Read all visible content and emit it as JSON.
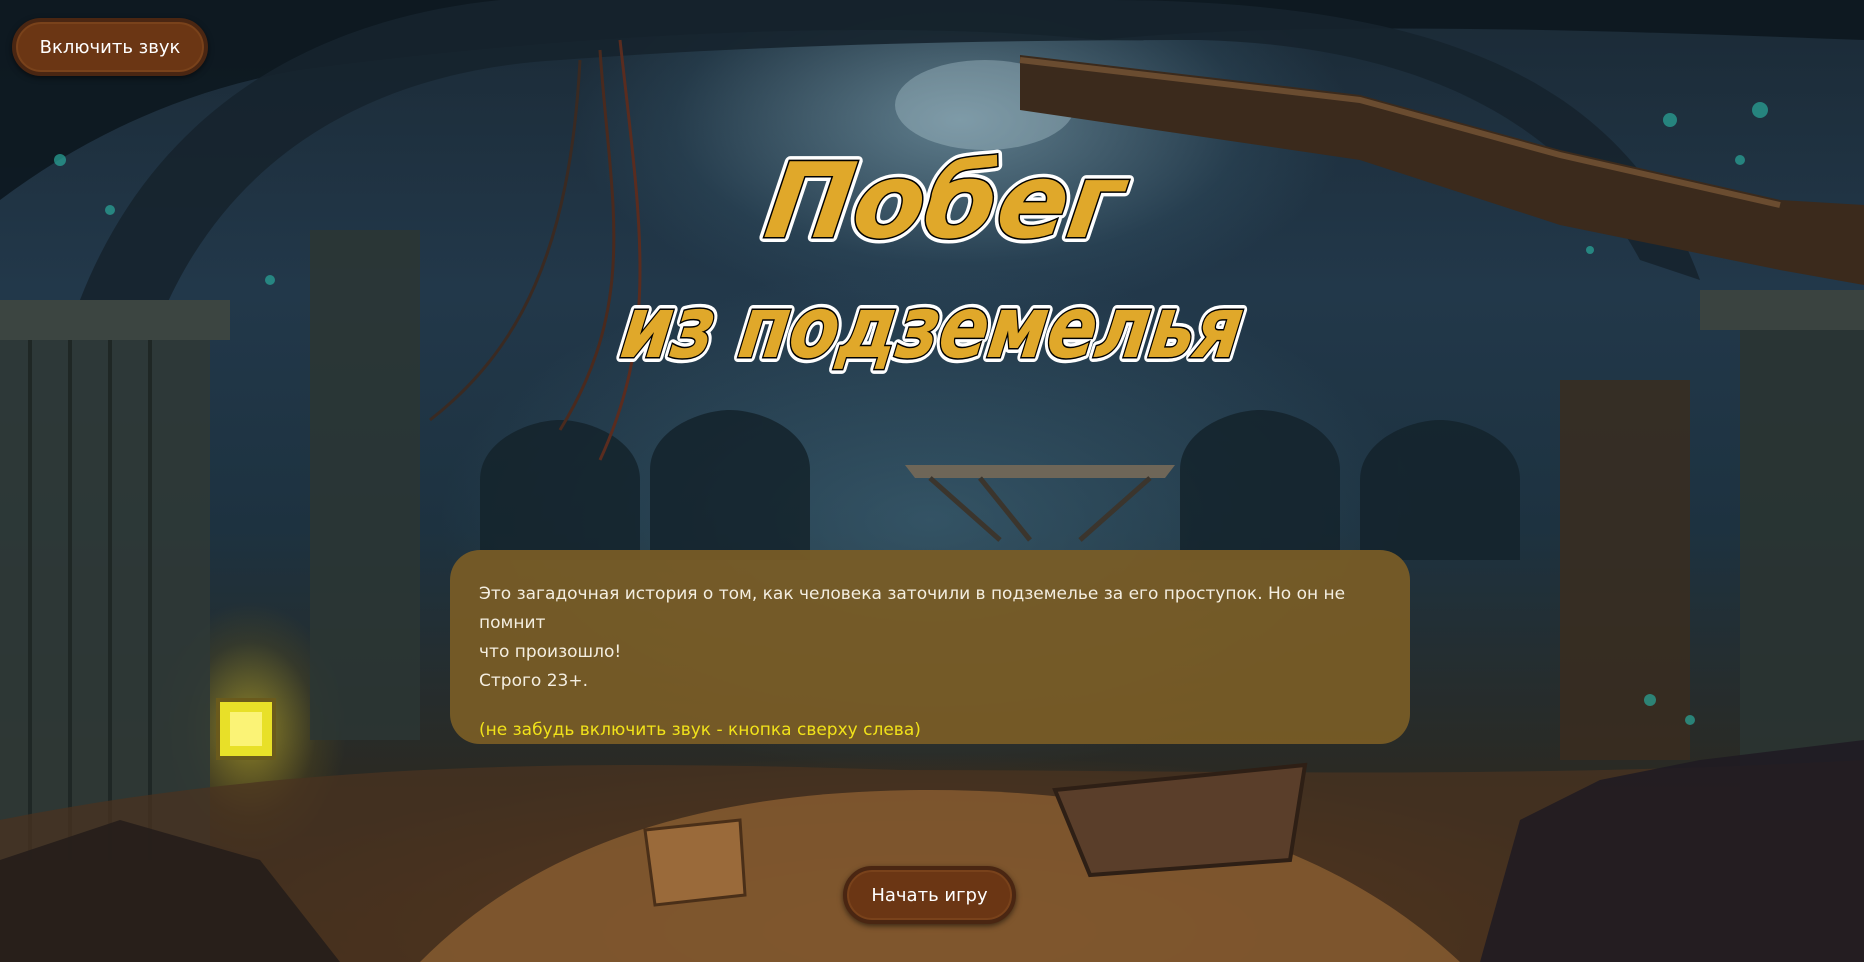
{
  "sound_button": {
    "label": "Включить звук"
  },
  "logo": {
    "line1": "Побег",
    "line2": "из подземелья",
    "fill_color": "#e0a82a",
    "outline_color": "#ffffff"
  },
  "info": {
    "line1": "Это загадочная история о том, как человека заточили в подземелье за его проступок. Но он не помнит",
    "line2": "что произошло!",
    "line3": "Строго 23+.",
    "hint": "(не забудь включить звук - кнопка сверху слева)"
  },
  "start_button": {
    "label": "Начать игру"
  },
  "colors": {
    "button_bg": "#6b3614",
    "panel_bg": "#7a5c26",
    "hint_text": "#f1e21a"
  }
}
